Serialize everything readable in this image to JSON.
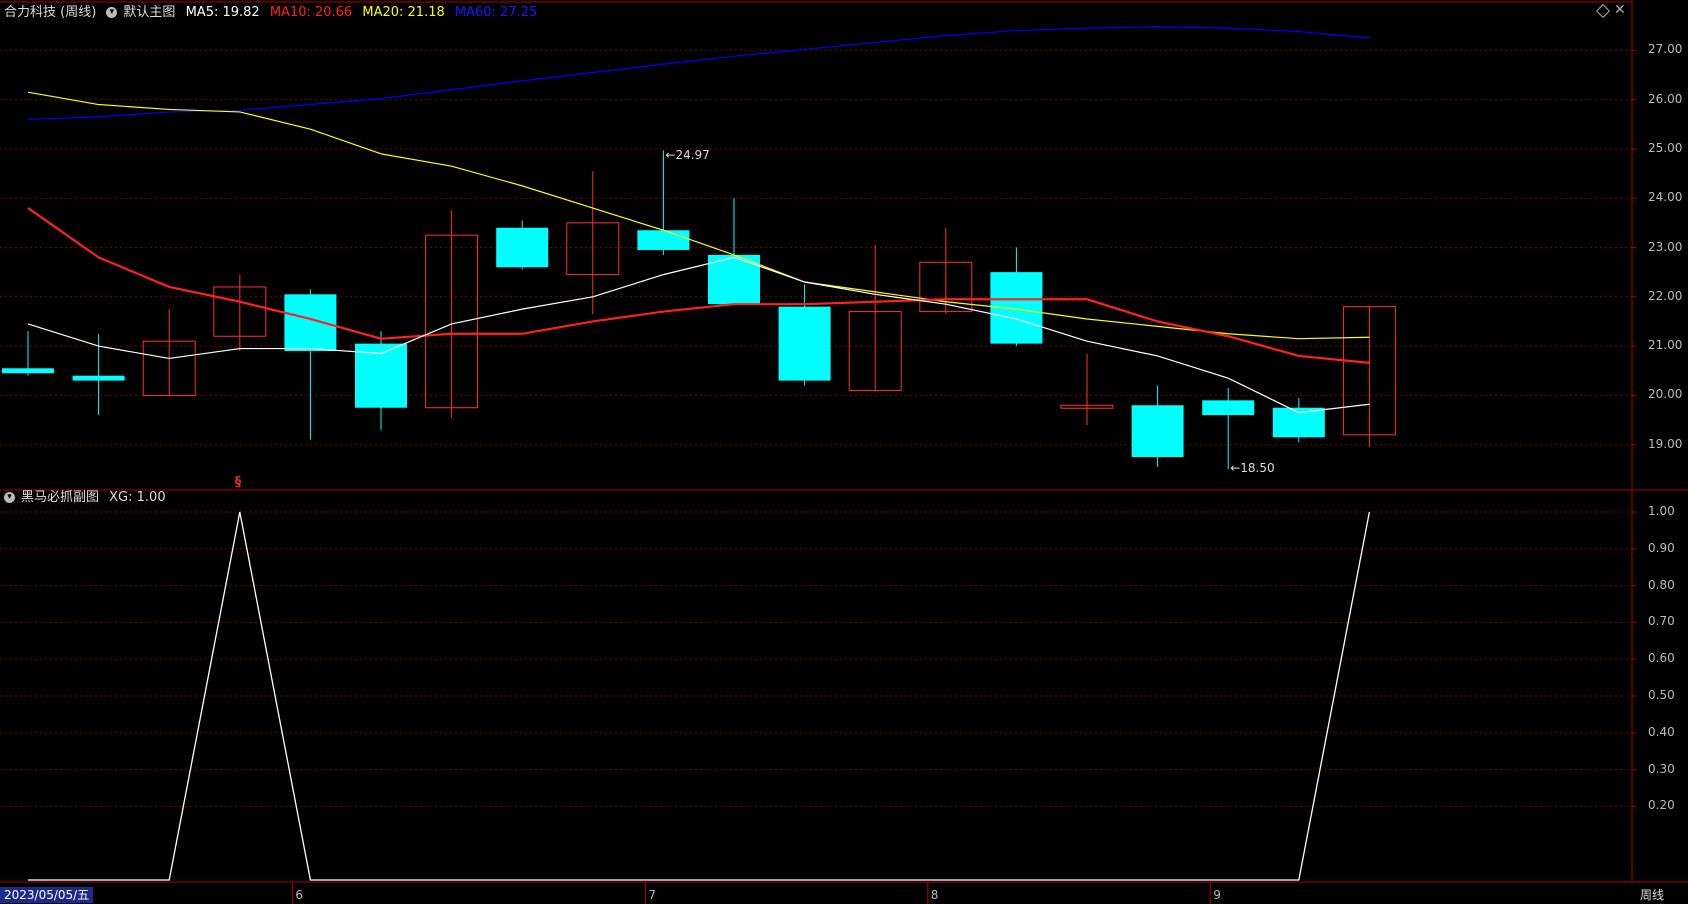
{
  "main_header": {
    "stock": "合力科技 (周线)",
    "template": "默认主图",
    "ma5_text": "MA5: 19.82",
    "ma10_text": "MA10: 20.66",
    "ma20_text": "MA20: 21.18",
    "ma60_text": "MA60: 27.25"
  },
  "sub_header": {
    "indicator": "黑马必抓副图",
    "xg_text": "XG: 1.00"
  },
  "colors": {
    "up": "#ff3030",
    "down": "#00ffff",
    "ma5": "#ffffff",
    "ma10": "#ff2020",
    "ma20": "#ffff00",
    "ma60": "#0000ff",
    "grid": "#7a0000",
    "border": "#b00000"
  },
  "chart_data": {
    "type": "candlestick",
    "price_ylim": [
      18.0,
      28.0
    ],
    "price_ticks": [
      "27.00",
      "26.00",
      "25.00",
      "24.00",
      "23.00",
      "22.00",
      "21.00",
      "20.00",
      "19.00"
    ],
    "candles": [
      {
        "o": 20.55,
        "c": 20.45,
        "h": 21.3,
        "l": 20.4
      },
      {
        "o": 20.4,
        "c": 20.3,
        "h": 21.25,
        "l": 19.6
      },
      {
        "o": 20.0,
        "c": 21.1,
        "h": 21.75,
        "l": 20.0
      },
      {
        "o": 21.2,
        "c": 22.2,
        "h": 22.45,
        "l": 20.9
      },
      {
        "o": 22.05,
        "c": 20.9,
        "h": 22.15,
        "l": 19.1
      },
      {
        "o": 21.05,
        "c": 19.75,
        "h": 21.3,
        "l": 19.3
      },
      {
        "o": 19.75,
        "c": 23.25,
        "h": 23.75,
        "l": 19.55
      },
      {
        "o": 23.4,
        "c": 22.6,
        "h": 23.55,
        "l": 22.55
      },
      {
        "o": 22.45,
        "c": 23.5,
        "h": 24.55,
        "l": 21.65
      },
      {
        "o": 23.35,
        "c": 22.95,
        "h": 24.97,
        "l": 22.85
      },
      {
        "o": 22.85,
        "c": 21.85,
        "h": 24.0,
        "l": 21.85
      },
      {
        "o": 21.8,
        "c": 20.3,
        "h": 22.25,
        "l": 20.2
      },
      {
        "o": 20.1,
        "c": 21.7,
        "h": 23.05,
        "l": 20.1
      },
      {
        "o": 21.7,
        "c": 22.7,
        "h": 23.4,
        "l": 21.65
      },
      {
        "o": 22.5,
        "c": 21.05,
        "h": 23.0,
        "l": 21.0
      },
      {
        "o": 19.75,
        "c": 19.8,
        "h": 20.85,
        "l": 19.4
      },
      {
        "o": 19.8,
        "c": 18.75,
        "h": 20.2,
        "l": 18.55
      },
      {
        "o": 19.9,
        "c": 19.6,
        "h": 20.15,
        "l": 18.5
      },
      {
        "o": 19.75,
        "c": 19.15,
        "h": 19.95,
        "l": 19.05
      },
      {
        "o": 19.2,
        "c": 21.8,
        "h": 21.8,
        "l": 18.95
      }
    ],
    "ma5": [
      21.45,
      21.0,
      20.75,
      20.95,
      20.95,
      20.85,
      21.45,
      21.75,
      22.0,
      22.45,
      22.8,
      22.3,
      22.05,
      21.85,
      21.55,
      21.1,
      20.8,
      20.35,
      19.65,
      19.82
    ],
    "ma10": [
      23.8,
      22.8,
      22.2,
      21.9,
      21.55,
      21.15,
      21.25,
      21.25,
      21.5,
      21.7,
      21.85,
      21.85,
      21.9,
      21.95,
      21.95,
      21.95,
      21.5,
      21.2,
      20.8,
      20.66
    ],
    "ma20": [
      26.15,
      25.9,
      25.8,
      25.75,
      25.4,
      24.9,
      24.65,
      24.25,
      23.8,
      23.35,
      22.85,
      22.3,
      22.1,
      21.9,
      21.75,
      21.55,
      21.4,
      21.25,
      21.15,
      21.18
    ],
    "ma60": [
      25.6,
      25.65,
      25.75,
      25.78,
      25.9,
      26.02,
      26.2,
      26.38,
      26.55,
      26.72,
      26.88,
      27.02,
      27.16,
      27.3,
      27.4,
      27.45,
      27.48,
      27.45,
      27.38,
      27.25
    ],
    "annotations": {
      "high_label": "24.97",
      "high_index": 9,
      "low_label": "18.50",
      "low_index": 17
    },
    "sub_ylim": [
      0.0,
      1.0
    ],
    "sub_ticks": [
      "1.00",
      "0.90",
      "0.80",
      "0.70",
      "0.60",
      "0.50",
      "0.40",
      "0.30",
      "0.20"
    ],
    "xg": [
      0,
      0,
      0,
      1,
      0,
      0,
      0,
      0,
      0,
      0,
      0,
      0,
      0,
      0,
      0,
      0,
      0,
      0,
      0,
      1
    ],
    "signal_marker": "§",
    "signal_index": 3,
    "x_labels": [
      {
        "text": "6",
        "index": 4
      },
      {
        "text": "7",
        "index": 9
      },
      {
        "text": "8",
        "index": 13
      },
      {
        "text": "9",
        "index": 17
      }
    ]
  },
  "footer": {
    "date": "2023/05/05/五",
    "period": "周线"
  }
}
